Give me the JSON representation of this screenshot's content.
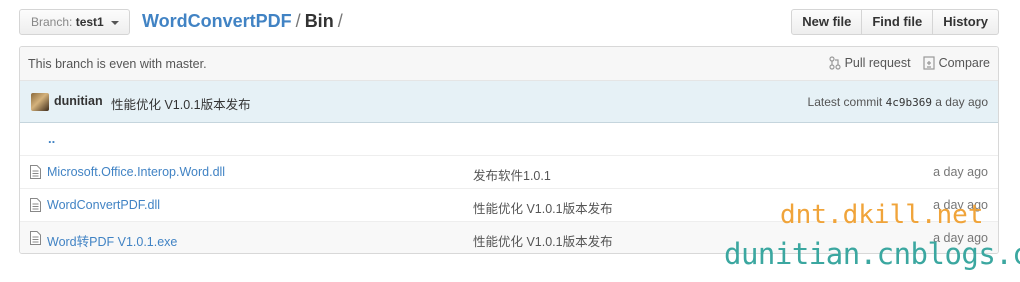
{
  "toolbar": {
    "branch_label": "Branch:",
    "branch_value": "test1",
    "repo": "WordConvertPDF",
    "separator1": "/",
    "current_dir": "Bin",
    "separator2": "/",
    "new_file": "New file",
    "find_file": "Find file",
    "history": "History"
  },
  "branch_info": {
    "message": "This branch is even with master.",
    "pull_request": "Pull request",
    "compare": "Compare"
  },
  "commit": {
    "author": "dunitian",
    "message": "性能优化 V1.0.1版本发布",
    "latest_label": "Latest commit",
    "sha": "4c9b369",
    "age": "a day ago"
  },
  "files": {
    "parent": "..",
    "items": [
      {
        "name": "Microsoft.Office.Interop.Word.dll",
        "message": "发布软件1.0.1",
        "age": "a day ago"
      },
      {
        "name": "WordConvertPDF.dll",
        "message": "性能优化 V1.0.1版本发布",
        "age": "a day ago"
      },
      {
        "name": "Word转PDF V1.0.1.exe",
        "message": "性能优化 V1.0.1版本发布",
        "age": "a day ago"
      }
    ]
  },
  "watermark": {
    "line1": "dnt.dkill.net",
    "line2": "dunitian.cnblogs.com"
  },
  "colors": {
    "link": "#4183c4",
    "commit_bg": "#e6f1f6",
    "watermark1": "#f0a43a",
    "watermark2": "#3ba7a0"
  },
  "icons": [
    "caret-down-icon",
    "pull-request-icon",
    "compare-icon",
    "file-icon",
    "avatar"
  ]
}
